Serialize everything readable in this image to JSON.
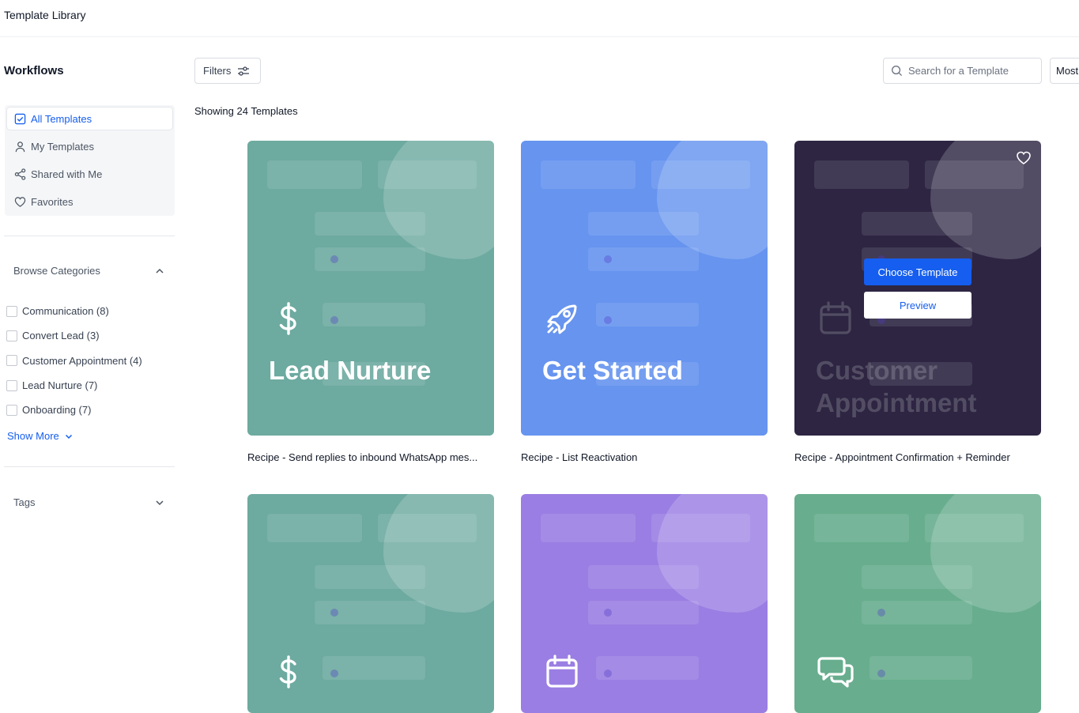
{
  "app": {
    "title": "Template Library"
  },
  "sidebar": {
    "heading": "Workflows",
    "nav": [
      {
        "label": "All Templates",
        "icon": "checkbox-checked-icon",
        "active": true
      },
      {
        "label": "My Templates",
        "icon": "user-icon"
      },
      {
        "label": "Shared with Me",
        "icon": "share-icon"
      },
      {
        "label": "Favorites",
        "icon": "heart-icon"
      }
    ],
    "browse": {
      "label": "Browse Categories",
      "categories": [
        "Communication (8)",
        "Convert Lead (3)",
        "Customer Appointment (4)",
        "Lead Nurture (7)",
        "Onboarding (7)"
      ],
      "show_more": "Show More"
    },
    "tags_label": "Tags"
  },
  "toolbar": {
    "filters_label": "Filters",
    "search_placeholder": "Search for a Template",
    "sort_label": "Most"
  },
  "results": {
    "showing": "Showing 24 Templates"
  },
  "cards": [
    {
      "title": "Lead Nurture",
      "icon": "dollar-icon",
      "caption": "Recipe - Send replies to inbound WhatsApp mes...",
      "color": "#6daaa0"
    },
    {
      "title": "Get Started",
      "icon": "rocket-icon",
      "caption": "Recipe - List Reactivation",
      "color": "#6694ef"
    },
    {
      "title": "Customer Appointment",
      "icon": "calendar-icon",
      "caption": "Recipe - Appointment Confirmation + Reminder",
      "color": "#2d2542",
      "hover": {
        "choose": "Choose Template",
        "preview": "Preview"
      }
    },
    {
      "title": "",
      "icon": "dollar-icon",
      "caption": "",
      "color": "#6daaa0"
    },
    {
      "title": "",
      "icon": "calendar-icon",
      "caption": "",
      "color": "#9a7ee3"
    },
    {
      "title": "",
      "icon": "chat-icon",
      "caption": "",
      "color": "#67ad8e"
    }
  ]
}
